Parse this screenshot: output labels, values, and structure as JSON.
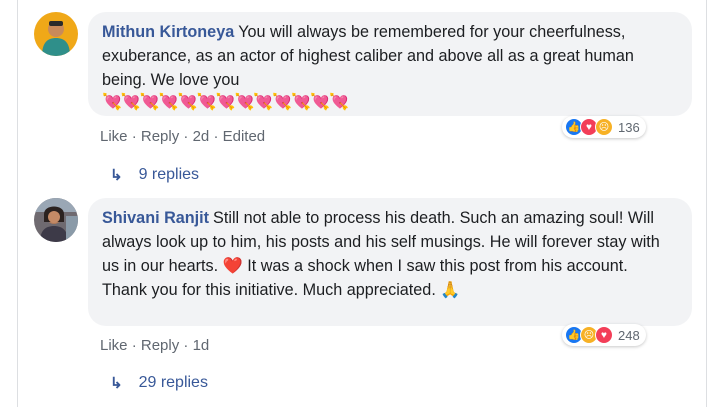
{
  "comments": [
    {
      "author": "Mithun Kirtoneya",
      "text": "You will always be remembered for your cheerfulness, exuberance, as an actor of highest caliber and above all as a great human being. We love you",
      "emoji_line": "💘💘💘💘💘💘💘💘💘💘💘💘💘",
      "like_label": "Like",
      "reply_label": "Reply",
      "time": "2d",
      "edited": "Edited",
      "reactions": [
        "like",
        "love",
        "sad"
      ],
      "reaction_count": "136",
      "replies_label": "9 replies"
    },
    {
      "author": "Shivani Ranjit",
      "text_part1": "Still not able to process his death. Such an amazing soul! Will always look up to him, his posts and his self musings. He will forever stay with us in our hearts.",
      "heart_emoji": "❤️",
      "text_part2": "It was a shock when I saw this post from his account.",
      "text_part3": "Thank you for this initiative. Much appreciated.",
      "pray_emoji": "🙏",
      "like_label": "Like",
      "reply_label": "Reply",
      "time": "1d",
      "reactions": [
        "like",
        "sad",
        "love"
      ],
      "reaction_count": "248",
      "replies_label": "29 replies"
    }
  ],
  "separator": "·",
  "colors": {
    "link": "#385898",
    "bubble": "#f2f3f5",
    "meta": "#606770"
  }
}
